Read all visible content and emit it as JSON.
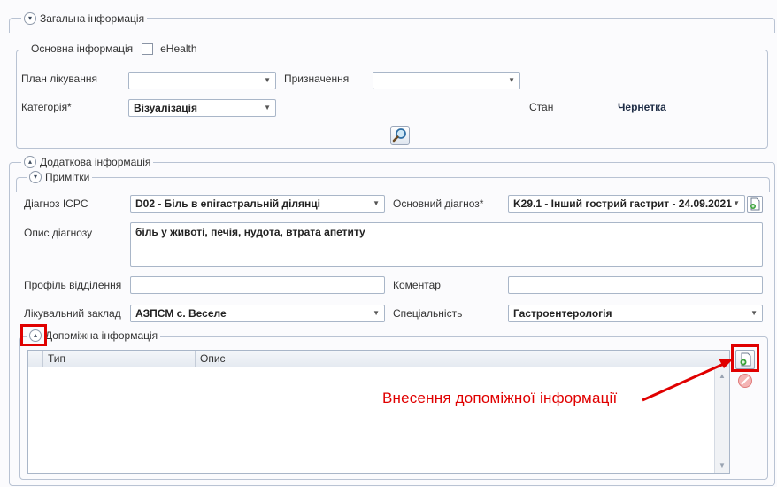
{
  "general": {
    "title": "Загальна інформація",
    "basic_group": {
      "title": "Основна інформація",
      "ehealth_label": "eHealth",
      "treatment_plan_label": "План лікування",
      "treatment_plan_value": "",
      "assignment_label": "Призначення",
      "assignment_value": "",
      "category_label": "Категорія*",
      "category_value": "Візуалізація",
      "status_label": "Стан",
      "status_value": "Чернетка"
    }
  },
  "additional": {
    "title": "Додаткова інформація",
    "notes_title": "Примітки",
    "icpc_label": "Діагноз ICPC",
    "icpc_value": "D02 - Біль в епігастральній ділянці",
    "main_diag_label": "Основний діагноз*",
    "main_diag_value": "K29.1 - Інший гострий гастрит - 24.09.2021",
    "diag_desc_label": "Опис діагнозу",
    "diag_desc_value": "біль у животі, печія, нудота, втрата апетиту",
    "dept_profile_label": "Профіль відділення",
    "dept_profile_value": "",
    "comment_label": "Коментар",
    "comment_value": "",
    "facility_label": "Лікувальний заклад",
    "facility_value": "АЗПСМ с. Веселе",
    "specialty_label": "Спеціальність",
    "specialty_value": "Гастроентерологія"
  },
  "aux": {
    "title": "Допоміжна інформація",
    "columns": [
      "Тип",
      "Опис"
    ],
    "annotation": "Внесення допоміжної інформації"
  },
  "colors": {
    "highlight": "#e00000",
    "annotation_text": "#e00000"
  },
  "icons": {
    "search": "magnifier-icon",
    "add": "add-document-icon",
    "delete": "delete-icon"
  }
}
